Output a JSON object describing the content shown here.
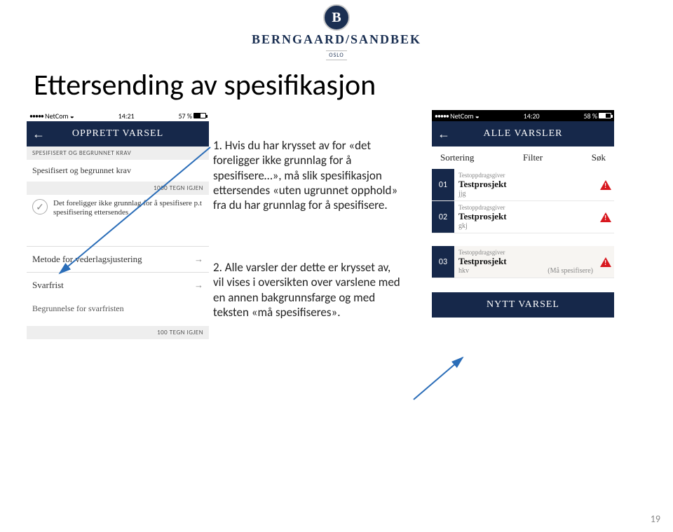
{
  "logo": {
    "letter": "B",
    "brand": "BERNGAARD/SANDBEK",
    "city": "OSLO"
  },
  "pageTitle": "Ettersending av spesifikasjon",
  "pageNumber": "19",
  "mid": {
    "p1": "1. Hvis du har krysset av for «det foreligger ikke grunnlag for å spesifisere…», må slik spesifikasjon ettersendes «uten ugrunnet opphold» fra du har grunnlag for å spesifisere.",
    "p2": "2. Alle varsler der dette er krysset av, vil vises i oversikten over varslene med en annen bakgrunnsfarge og med teksten «må spesifiseres»."
  },
  "left": {
    "status": {
      "carrier": "NetCom",
      "time": "14:21",
      "pct": "57 %",
      "fill": 57
    },
    "title": "OPPRETT VARSEL",
    "sub1": "SPESIFISERT OG BEGRUNNET KRAV",
    "sub1r": "",
    "ta1": "Spesifisert og begrunnet krav",
    "sub1right": "1000 TEGN IGJEN",
    "chk1": "Det foreligger ikke grunnlag for å spesifisere p.t  spesifisering ettersendes",
    "row1": "Metode for vederlagsjustering",
    "row2": "Svarfrist",
    "ta2": "Begrunnelse for svarfristen",
    "sub2right": "100 TEGN IGJEN"
  },
  "right": {
    "status": {
      "carrier": "NetCom",
      "time": "14:20",
      "pct": "58 %",
      "fill": 58
    },
    "title": "ALLE VARSLER",
    "filter": {
      "a": "Sortering",
      "b": "Filter",
      "c": "Søk"
    },
    "items": [
      {
        "n": "01",
        "over": "Testoppdragsgiver",
        "main": "Testprosjekt",
        "under": "jjg",
        "extra": "",
        "hi": false
      },
      {
        "n": "02",
        "over": "Testoppdragsgiver",
        "main": "Testprosjekt",
        "under": "gkj",
        "extra": "",
        "hi": false
      },
      {
        "n": "03",
        "over": "Testoppdragsgiver",
        "main": "Testprosjekt",
        "under": "hkv",
        "extra": "(Må spesifisere)",
        "hi": true
      }
    ],
    "btn": "NYTT VARSEL"
  }
}
